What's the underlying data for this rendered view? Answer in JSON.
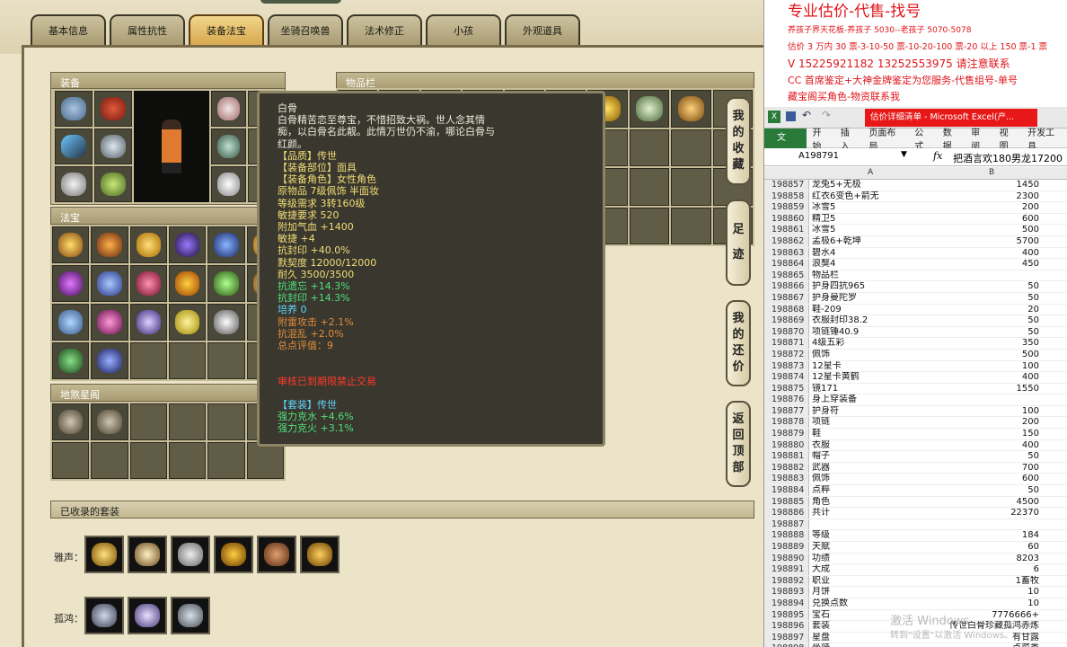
{
  "tabs": [
    "基本信息",
    "属性抗性",
    "装备法宝",
    "坐骑召唤兽",
    "法术修正",
    "小孩",
    "外观道具"
  ],
  "active_tab": 2,
  "sections": {
    "equip": "装备",
    "items": "物品栏",
    "fabao": "法宝",
    "ling": "地煞星阁",
    "suit": "已收录的套装"
  },
  "tooltip": {
    "lines": [
      {
        "t": "白骨",
        "c": "c-white"
      },
      {
        "t": "白骨精苦恋至尊宝，不惜招致大祸。世人念其情",
        "c": "c-white"
      },
      {
        "t": "痴，以白骨名此靓。此情万世仍不渝，哪论白骨与",
        "c": "c-white"
      },
      {
        "t": "红颜。",
        "c": "c-white"
      },
      {
        "t": "【品质】传世",
        "c": "c-yellow"
      },
      {
        "t": "【装备部位】面具",
        "c": "c-yellow"
      },
      {
        "t": "【装备角色】女性角色",
        "c": "c-yellow"
      },
      {
        "t": "原物品 7级佩饰 半面妆",
        "c": "c-yellow"
      },
      {
        "t": "等级需求 3转160级",
        "c": "c-yellow"
      },
      {
        "t": "敏捷要求 520",
        "c": "c-yellow"
      },
      {
        "t": "附加气血 +1400",
        "c": "c-yellow"
      },
      {
        "t": "敏捷 +4",
        "c": "c-yellow"
      },
      {
        "t": "抗封印 +40.0%",
        "c": "c-yellow"
      },
      {
        "t": "默契度 12000/12000",
        "c": "c-yellow"
      },
      {
        "t": "耐久 3500/3500",
        "c": "c-yellow"
      },
      {
        "t": "抗遗忘 +14.3%",
        "c": "c-green"
      },
      {
        "t": "抗封印 +14.3%",
        "c": "c-green"
      },
      {
        "t": "培养 0",
        "c": "c-cyan"
      },
      {
        "t": "附雷攻击 +2.1%",
        "c": "c-orange"
      },
      {
        "t": "抗混乱 +2.0%",
        "c": "c-orange"
      },
      {
        "t": "总点评值：9",
        "c": "c-orange"
      },
      {
        "t": "",
        "c": "c-white"
      },
      {
        "t": "",
        "c": "c-white"
      },
      {
        "t": "审核已到期限禁止交易",
        "c": "c-red"
      },
      {
        "t": "",
        "c": "c-white"
      },
      {
        "t": "【套装】传世",
        "c": "c-cyan"
      },
      {
        "t": "强力克水 +4.6%",
        "c": "c-green"
      },
      {
        "t": "强力克火 +3.1%",
        "c": "c-green"
      }
    ]
  },
  "sidebuttons": [
    {
      "chars": [
        "我",
        "的",
        "收",
        "藏"
      ]
    },
    {
      "chars": [
        "足",
        "迹"
      ]
    },
    {
      "chars": [
        "我",
        "的",
        "还",
        "价"
      ]
    },
    {
      "chars": [
        "返",
        "回",
        "顶",
        "部"
      ]
    }
  ],
  "suits": [
    {
      "label": "雅声：",
      "count": 6
    },
    {
      "label": "孤鸿：",
      "count": 3
    }
  ],
  "excel": {
    "red_lines": [
      "专业估价-代售-找号",
      "养孩子界天花板-养孩子 5030--老孩子 5070-5078",
      "估价 3 万内 30 票-3-10-50 票-10-20-100 票-20 以上 150 票-1 票",
      "V 15225921182        13252553975  请注意联系",
      "CC 首席鉴定+大神金牌鉴定为您服务-代售组号-单号",
      "藏宝阁买角色-物资联系我"
    ],
    "title_bar": "估价详细清单 - Microsoft Excel(产...",
    "ribbon_tabs": [
      "文件",
      "开始",
      "插入",
      "页面布局",
      "公式",
      "数据",
      "审阅",
      "视图",
      "开发工具"
    ],
    "cell_ref": "A198791",
    "formula": "把酒言欢180男龙17200",
    "col_a": "A",
    "col_b": "B",
    "rows": [
      {
        "n": "198857",
        "a": "龙兔5+无极",
        "b": "1450"
      },
      {
        "n": "198858",
        "a": "红衣6变色+箭无",
        "b": "2300"
      },
      {
        "n": "198859",
        "a": "冰雪5",
        "b": "200"
      },
      {
        "n": "198860",
        "a": "精卫5",
        "b": "600"
      },
      {
        "n": "198861",
        "a": "冰雪5",
        "b": "500"
      },
      {
        "n": "198862",
        "a": "孟极6+乾坤",
        "b": "5700"
      },
      {
        "n": "198863",
        "a": "碧水4",
        "b": "400"
      },
      {
        "n": "198864",
        "a": "浪獒4",
        "b": "450"
      },
      {
        "n": "198865",
        "a": "物品栏",
        "b": ""
      },
      {
        "n": "198866",
        "a": "护身四抗965",
        "b": "50"
      },
      {
        "n": "198867",
        "a": "护身曼陀罗",
        "b": "50"
      },
      {
        "n": "198868",
        "a": "鞋-209",
        "b": "20"
      },
      {
        "n": "198869",
        "a": "衣服封印38.2",
        "b": "50"
      },
      {
        "n": "198870",
        "a": "项链锤40.9",
        "b": "50"
      },
      {
        "n": "198871",
        "a": "4级五彩",
        "b": "350"
      },
      {
        "n": "198872",
        "a": "佩饰",
        "b": "500"
      },
      {
        "n": "198873",
        "a": "12星卡",
        "b": "100"
      },
      {
        "n": "198874",
        "a": "12星卡黄鹤",
        "b": "400"
      },
      {
        "n": "198875",
        "a": "镜171",
        "b": "1550"
      },
      {
        "n": "198876",
        "a": "身上穿装备",
        "b": ""
      },
      {
        "n": "198877",
        "a": "护身符",
        "b": "100"
      },
      {
        "n": "198878",
        "a": "项链",
        "b": "200"
      },
      {
        "n": "198879",
        "a": "鞋",
        "b": "150"
      },
      {
        "n": "198880",
        "a": "衣服",
        "b": "400"
      },
      {
        "n": "198881",
        "a": "帽子",
        "b": "50"
      },
      {
        "n": "198882",
        "a": "武器",
        "b": "700"
      },
      {
        "n": "198883",
        "a": "佩饰",
        "b": "600"
      },
      {
        "n": "198884",
        "a": "点粹",
        "b": "50"
      },
      {
        "n": "198885",
        "a": "角色",
        "b": "4500"
      },
      {
        "n": "198886",
        "a": "共计",
        "b": "22370"
      },
      {
        "n": "198887",
        "a": "",
        "b": ""
      },
      {
        "n": "198888",
        "a": "等级",
        "b": "184"
      },
      {
        "n": "198889",
        "a": "天赋",
        "b": "60"
      },
      {
        "n": "198890",
        "a": "功绩",
        "b": "8203"
      },
      {
        "n": "198891",
        "a": "大成",
        "b": "6"
      },
      {
        "n": "198892",
        "a": "职业",
        "b": "1畜牧"
      },
      {
        "n": "198893",
        "a": "月饼",
        "b": "10"
      },
      {
        "n": "198894",
        "a": "兑换点数",
        "b": "10"
      },
      {
        "n": "198895",
        "a": "宝石",
        "b": "7776666+"
      },
      {
        "n": "198896",
        "a": "套装",
        "b": "传世白骨珍藏孤鸿赤炼"
      },
      {
        "n": "198897",
        "a": "星盘",
        "b": "有甘露"
      },
      {
        "n": "198898",
        "a": "坐骑",
        "b": "点菜类"
      }
    ],
    "watermark1": "激活 Windows",
    "watermark2": "转到\"设置\"以激活 Windows。"
  },
  "colors": {
    "accent": "#d6a84f",
    "sheet_red": "#e0141a",
    "excel_green": "#2a7a3a"
  }
}
